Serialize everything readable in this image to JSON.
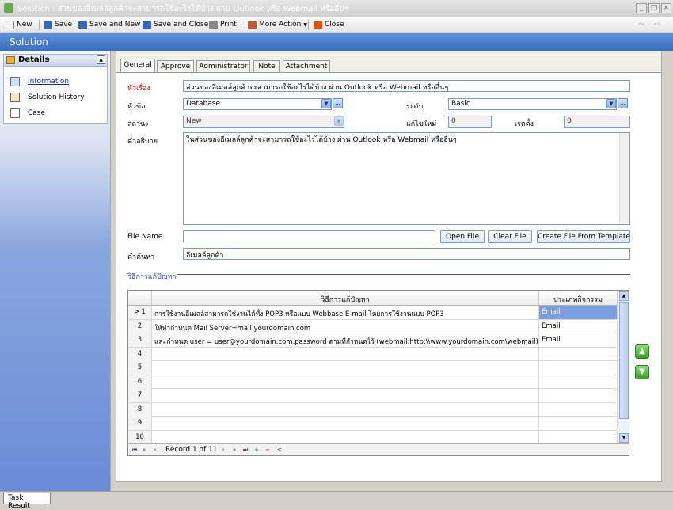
{
  "window": {
    "title": "Solution : ส่วนของอีเมลล์ลูกค้าจะสามารถใช้อะไรได้บ้าง ผ่าน Outlook หรือ Webmail หรืออื่นๆ",
    "controls": [
      "_",
      "□",
      "×"
    ]
  },
  "toolbar": {
    "new": "New",
    "save": "Save",
    "save_new": "Save and New",
    "save_close": "Save and Close",
    "print": "Print",
    "more_action": "More Action",
    "close": "Close",
    "back": "⇦",
    "forward": "⇨"
  },
  "header": {
    "title": "Solution"
  },
  "sidebar": {
    "section_title": "Details",
    "collapse": "▲",
    "items": [
      {
        "label": "Information",
        "icon": "info-icon"
      },
      {
        "label": "Solution History",
        "icon": "history-icon"
      },
      {
        "label": "Case",
        "icon": "case-icon"
      }
    ]
  },
  "tabs": [
    "General",
    "Approve",
    "Administrator",
    "Note",
    "Attachment"
  ],
  "form": {
    "subject_label": "หัวเรื่อง",
    "subject_value": "ส่วนของอีเมลล์ลูกค้าจะสามารถใช้อะไรได้บ้าง ผ่าน Outlook หรือ Webmail หรืออื่นๆ",
    "topic_label": "หัวข้อ",
    "topic_value": "Database",
    "level_label": "ระดับ",
    "level_value": "Basic",
    "status_label": "สถานะ",
    "status_value": "New",
    "edit_label": "แก้ไขใหม่",
    "edit_value": "0",
    "rating_label": "เรตติ้ง",
    "rating_value": "0",
    "desc_label": "คำอธิบาย",
    "desc_value": "ในส่วนของอีเมลล์ลูกค้าจะสามารถใช้อะไรได้บ้าง ผ่าน Outlook หรือ Webmail หรืออื่นๆ",
    "file_label": "File Name",
    "file_value": "",
    "open_file": "Open File",
    "clear_file": "Clear File",
    "create_template": "Create File From Template",
    "keyword_label": "คำค้นหา",
    "keyword_value": "อีเมลล์ลูกค้า",
    "section_label": "วิธีการแก้ปัญหา",
    "ellipsis": "...",
    "dropdown_arrow": "▼"
  },
  "grid": {
    "columns": [
      "วิธีการแก้ปัญหา",
      "ประเภทกิจกรรม"
    ],
    "rows": [
      {
        "num": "1",
        "marker": ">",
        "solution": "การใช้งานอีเมลล์สามารถใช้งานได้ทั้ง POP3 หรือแบบ Webbase E-mail โดยการใช้งานแบบ POP3",
        "type": "Email"
      },
      {
        "num": "2",
        "solution": "ให้ทำกำหนด Mail Server=mail.yourdomain.com",
        "type": "Email"
      },
      {
        "num": "3",
        "solution": "และกำหนด user = user@yourdomain.com,password ตามที่กำหนดไว้ (webmail:http:\\\\www.yourdomain.com\\webmail)",
        "type": "Email"
      },
      {
        "num": "4",
        "solution": "",
        "type": ""
      },
      {
        "num": "5",
        "solution": "",
        "type": ""
      },
      {
        "num": "6",
        "solution": "",
        "type": ""
      },
      {
        "num": "7",
        "solution": "",
        "type": ""
      },
      {
        "num": "8",
        "solution": "",
        "type": ""
      },
      {
        "num": "9",
        "solution": "",
        "type": ""
      },
      {
        "num": "10",
        "solution": "",
        "type": ""
      }
    ],
    "record_text": "Record 1 of 11",
    "nav": {
      "first": "⏮",
      "prev_page": "«",
      "prev": "‹",
      "next": "›",
      "next_page": "»",
      "last": "⏭",
      "add": "+",
      "remove": "−",
      "scroll_left": "<"
    },
    "scroll_up": "▲",
    "scroll_down": "▼"
  },
  "move_up": "▲",
  "move_down": "▼",
  "status": {
    "task_tab": "Task Result"
  },
  "colors": {
    "header": "#3a6fc0",
    "selected": "#7d9edc",
    "red_label": "#cc0000"
  }
}
